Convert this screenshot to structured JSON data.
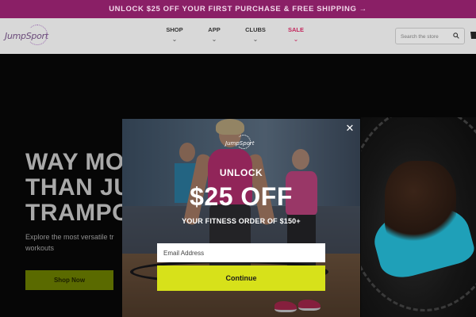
{
  "promo": {
    "text": "UNLOCK $25 OFF YOUR FIRST PURCHASE & FREE SHIPPING →"
  },
  "header": {
    "logo_text": "JumpSport",
    "nav": [
      {
        "label": "SHOP"
      },
      {
        "label": "APP"
      },
      {
        "label": "CLUBS"
      },
      {
        "label": "SALE"
      }
    ],
    "search": {
      "placeholder": "Search the store",
      "icon": "search-icon"
    },
    "cart_icon": "cart-icon"
  },
  "hero": {
    "headline_lines": [
      "WAY MO",
      "THAN JU",
      "TRAMPO"
    ],
    "subtitle": "Explore the most versatile tr workouts",
    "button_label": "Shop Now"
  },
  "modal": {
    "close_glyph": "✕",
    "logo_text": "JumpSport",
    "unlock": "UNLOCK",
    "offer": "$25 OFF",
    "order_text": "YOUR FITNESS ORDER OF $150+",
    "email_placeholder": "Email Address",
    "continue_label": "Continue"
  },
  "colors": {
    "promo_bg": "#8a1f66",
    "sale": "#c3265c",
    "continue_bg": "#d7e11a",
    "hero_button": "#5a6a00"
  }
}
